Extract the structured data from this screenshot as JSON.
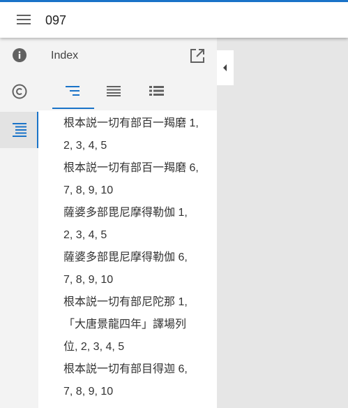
{
  "header": {
    "title": "097",
    "menu_icon": "hamburger-menu-icon"
  },
  "rail": {
    "items": [
      {
        "name": "info",
        "icon": "info-icon"
      },
      {
        "name": "copyright",
        "icon": "copyright-icon"
      },
      {
        "name": "index",
        "icon": "index-list-icon",
        "active": true
      }
    ]
  },
  "panel": {
    "title": "Index",
    "popout_icon": "open-in-new-icon",
    "tabs": [
      {
        "name": "tree",
        "icon": "tree-index-icon",
        "active": true
      },
      {
        "name": "list",
        "icon": "list-icon"
      },
      {
        "name": "thumbnails",
        "icon": "thumbnail-list-icon"
      }
    ]
  },
  "index": {
    "items": [
      {
        "line1": "根本説一切有部百一羯磨 1,",
        "line2": "2, 3, 4, 5"
      },
      {
        "line1": "根本説一切有部百一羯磨 6,",
        "line2": "7, 8, 9, 10"
      },
      {
        "line1": "薩婆多部毘尼摩得勒伽 1,",
        "line2": "2, 3, 4, 5"
      },
      {
        "line1": "薩婆多部毘尼摩得勒伽 6,",
        "line2": "7, 8, 9, 10"
      },
      {
        "line1": "根本説一切有部尼陀那 1,",
        "line2": "「大唐景龍四年」譯場列",
        "line3": "位, 2, 3, 4, 5"
      },
      {
        "line1": "根本説一切有部目得迦 6,",
        "line2": "7, 8, 9, 10"
      }
    ]
  },
  "collapse": {
    "icon": "chevron-left-icon"
  },
  "colors": {
    "accent": "#1a73c8",
    "rail_bg": "#f3f3f3",
    "viewer_bg": "#e6e6e6"
  }
}
